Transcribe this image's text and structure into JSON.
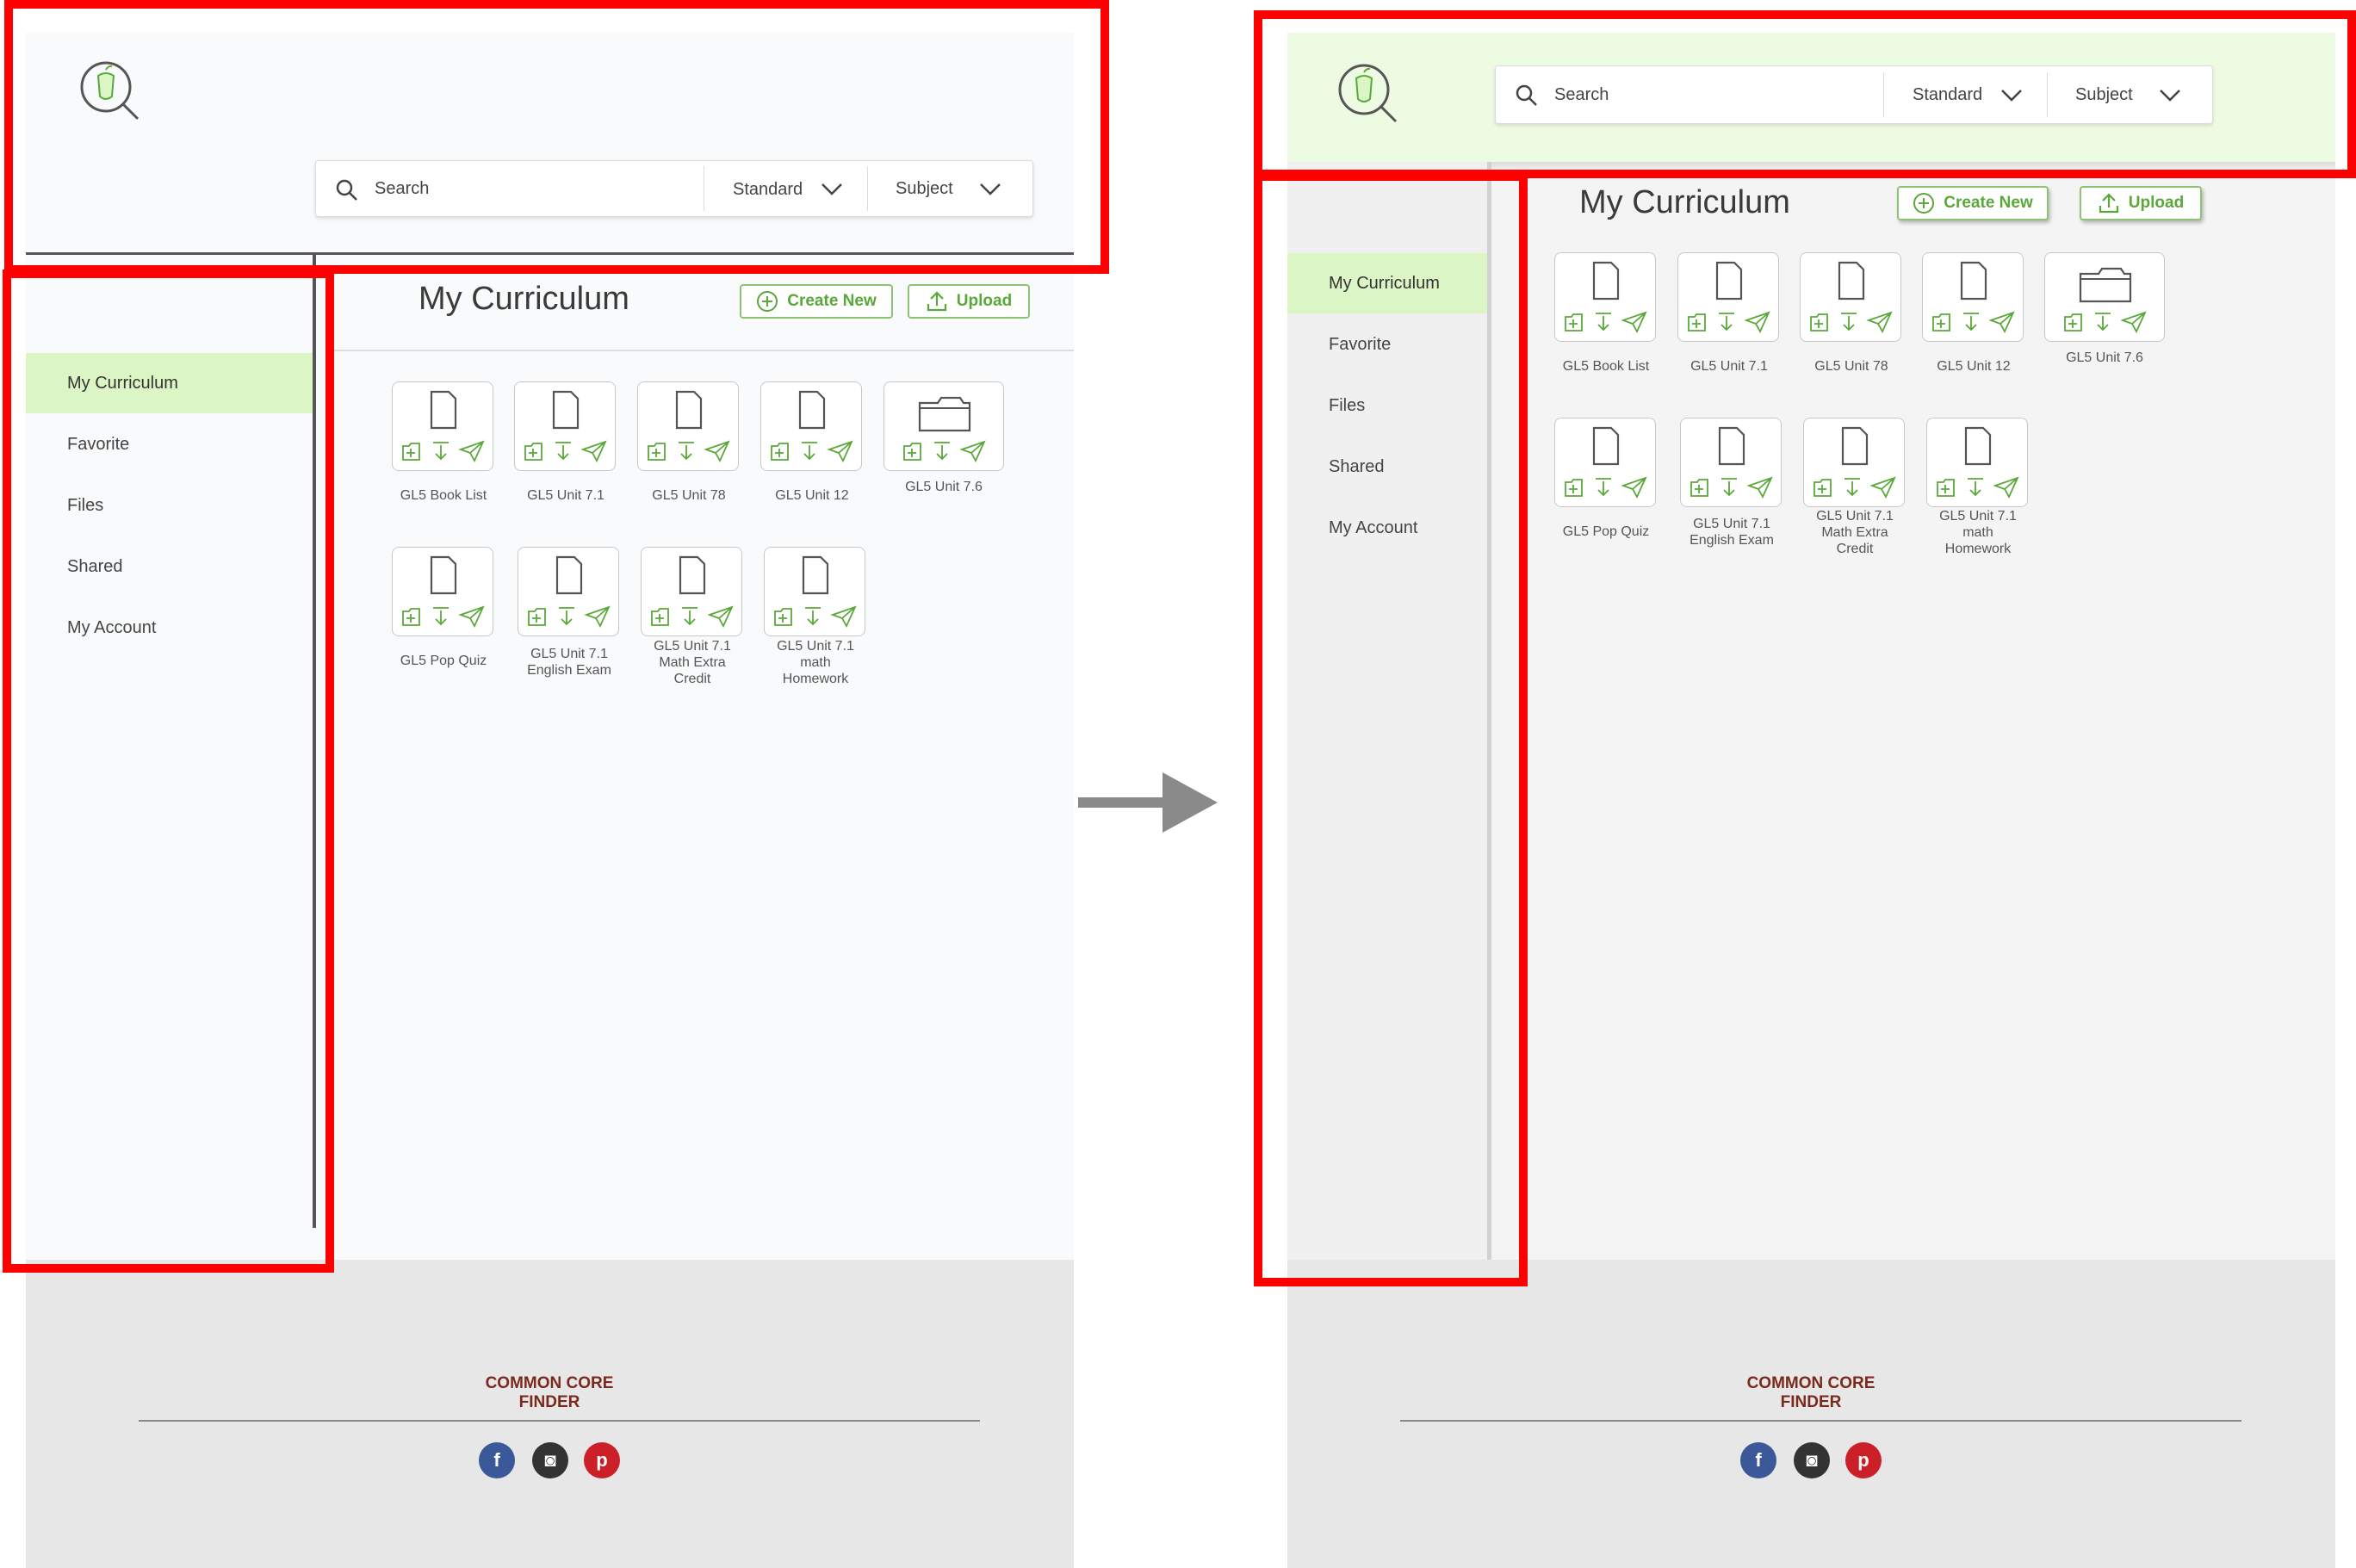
{
  "colors": {
    "accent_green": "#5aa83a",
    "active_nav_bg": "#dcf5c4",
    "header_bg_after": "#eefbe3",
    "annotation_red": "#ff0000",
    "brand_text": "#7a2a1c",
    "facebook": "#3b5998",
    "instagram": "#333333",
    "pinterest": "#cb2027"
  },
  "search": {
    "placeholder": "Search",
    "standard_label": "Standard",
    "subject_label": "Subject"
  },
  "nav": {
    "items": [
      {
        "label": "My Curriculum",
        "active": true
      },
      {
        "label": "Favorite"
      },
      {
        "label": "Files"
      },
      {
        "label": "Shared"
      },
      {
        "label": "My Account"
      }
    ]
  },
  "main": {
    "title": "My Curriculum",
    "create_new_label": "Create New",
    "upload_label": "Upload",
    "files": [
      {
        "name": "GL5 Book List",
        "icon": "document-icon"
      },
      {
        "name": "GL5 Unit 7.1",
        "icon": "document-icon"
      },
      {
        "name": "GL5 Unit 78",
        "icon": "document-icon"
      },
      {
        "name": "GL5 Unit 12",
        "icon": "document-icon"
      },
      {
        "name": "GL5 Unit 7.6",
        "icon": "folder-icon"
      },
      {
        "name": "GL5 Pop Quiz",
        "icon": "document-icon"
      },
      {
        "name": "GL5 Unit 7.1\nEnglish Exam",
        "icon": "document-icon"
      },
      {
        "name": "GL5 Unit 7.1\nMath Extra\nCredit",
        "icon": "document-icon"
      },
      {
        "name": "GL5 Unit 7.1\nmath\nHomework",
        "icon": "document-icon"
      }
    ]
  },
  "footer": {
    "brand": "COMMON CORE\nFINDER",
    "social": [
      {
        "icon": "facebook-icon",
        "glyph": "f"
      },
      {
        "icon": "instagram-icon",
        "glyph": "◙"
      },
      {
        "icon": "pinterest-icon",
        "glyph": "p"
      }
    ]
  }
}
